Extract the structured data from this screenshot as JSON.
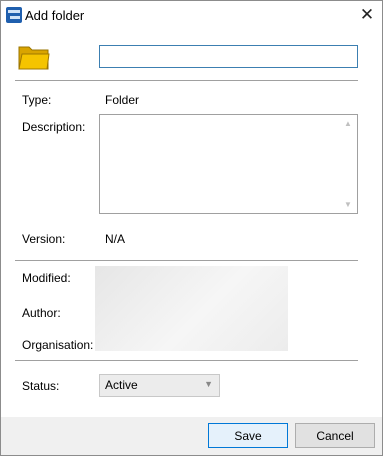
{
  "window": {
    "title": "Add folder",
    "close_glyph": "✕",
    "icon": "app-icon"
  },
  "form": {
    "folder_icon": "folder-icon",
    "name_value": "",
    "type_label": "Type:",
    "type_value": "Folder",
    "description_label": "Description:",
    "description_value": "",
    "version_label": "Version:",
    "version_value": "N/A",
    "modified_label": "Modified:",
    "author_label": "Author:",
    "organisation_label": "Organisation:",
    "status_label": "Status:",
    "status_value": "Active"
  },
  "footer": {
    "save_label": "Save",
    "cancel_label": "Cancel"
  },
  "colors": {
    "input_border_focus": "#3c7fb1",
    "folder_yellow": "#f5c400",
    "default_button_border": "#0078d7"
  }
}
